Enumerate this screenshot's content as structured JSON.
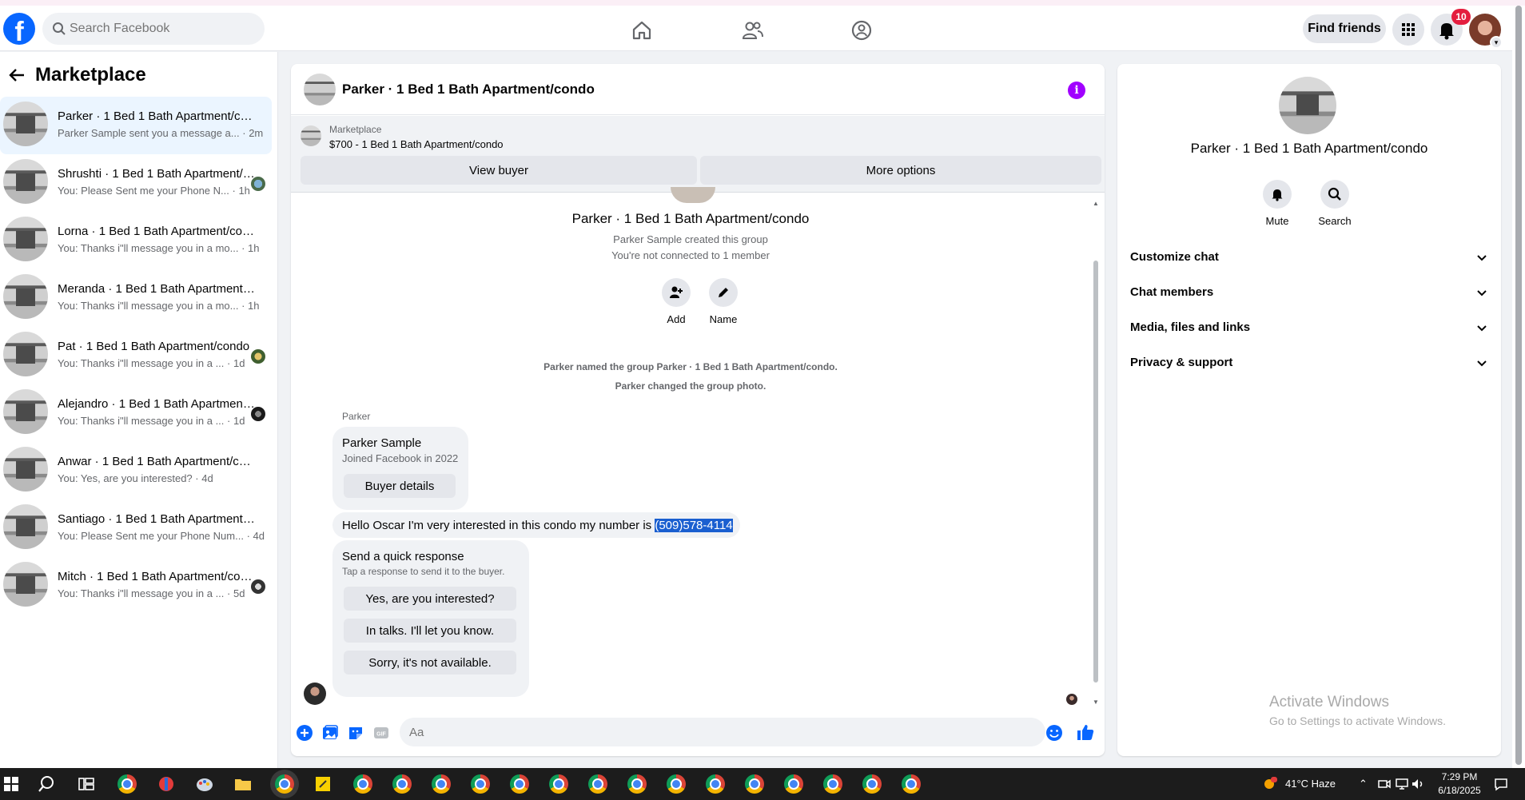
{
  "header": {
    "search_placeholder": "Search Facebook",
    "find_friends": "Find friends",
    "notification_count": "10"
  },
  "sidebar": {
    "title": "Marketplace",
    "conversations": [
      {
        "name": "Parker · 1 Bed 1 Bath Apartment/condo",
        "preview": "Parker Sample sent you a message a...",
        "time": "· 2m"
      },
      {
        "name": "Shrushti · 1 Bed 1 Bath Apartment/condo",
        "preview": "You: Please Sent me your Phone N...",
        "time": "· 1h"
      },
      {
        "name": "Lorna · 1 Bed 1 Bath Apartment/condo",
        "preview": "You: Thanks i\"ll message you in a mo...",
        "time": "· 1h"
      },
      {
        "name": "Meranda · 1 Bed 1 Bath Apartment/condo",
        "preview": "You: Thanks i\"ll message you in a mo...",
        "time": "· 1h"
      },
      {
        "name": "Pat · 1 Bed 1 Bath Apartment/condo",
        "preview": "You: Thanks i\"ll message you in a ...",
        "time": "· 1d"
      },
      {
        "name": "Alejandro · 1 Bed 1 Bath Apartment/condo",
        "preview": "You: Thanks i\"ll message you in a ...",
        "time": "· 1d"
      },
      {
        "name": "Anwar · 1 Bed 1 Bath Apartment/condo",
        "preview": "You: Yes, are you interested?",
        "time": "· 4d"
      },
      {
        "name": "Santiago · 1 Bed 1 Bath Apartment/condo",
        "preview": "You: Please Sent me your Phone Num...",
        "time": "· 4d"
      },
      {
        "name": "Mitch · 1 Bed 1 Bath Apartment/condo",
        "preview": "You: Thanks i\"ll message you in a ...",
        "time": "· 5d"
      }
    ]
  },
  "chat": {
    "title": "Parker · 1 Bed 1 Bath Apartment/condo",
    "marketplace_label": "Marketplace",
    "listing": "$700 - 1 Bed 1 Bath Apartment/condo",
    "view_buyer": "View buyer",
    "more_options": "More options",
    "group_name": "Parker · 1 Bed 1 Bath Apartment/condo",
    "created_by": "Parker Sample created this group",
    "not_connected": "You're not connected to 1 member",
    "add_label": "Add",
    "name_label": "Name",
    "note_named": "Parker named the group Parker · 1 Bed 1 Bath Apartment/condo.",
    "note_photo": "Parker changed the group photo.",
    "sender": "Parker",
    "profile_name": "Parker Sample",
    "profile_joined": "Joined Facebook in 2022",
    "buyer_details": "Buyer details",
    "message_text": "Hello Oscar I'm very interested in this condo my number is ",
    "message_phone": "(509)578-4114",
    "quick_title": "Send a quick response",
    "quick_sub": "Tap a response to send it to the buyer.",
    "quick_responses": [
      "Yes, are you interested?",
      "In talks. I'll let you know.",
      "Sorry, it's not available."
    ],
    "composer_placeholder": "Aa"
  },
  "right_panel": {
    "name": "Parker · 1 Bed 1 Bath Apartment/condo",
    "mute": "Mute",
    "search": "Search",
    "sections": [
      "Customize chat",
      "Chat members",
      "Media, files and links",
      "Privacy & support"
    ]
  },
  "watermark": {
    "line1": "Activate Windows",
    "line2": "Go to Settings to activate Windows."
  },
  "taskbar": {
    "weather": "41°C  Haze",
    "time": "7:29 PM",
    "date": "6/18/2025"
  },
  "colors": {
    "facebook_blue": "#0866ff",
    "active_conv": "#ebf5ff",
    "info_purple": "#a100ff"
  }
}
